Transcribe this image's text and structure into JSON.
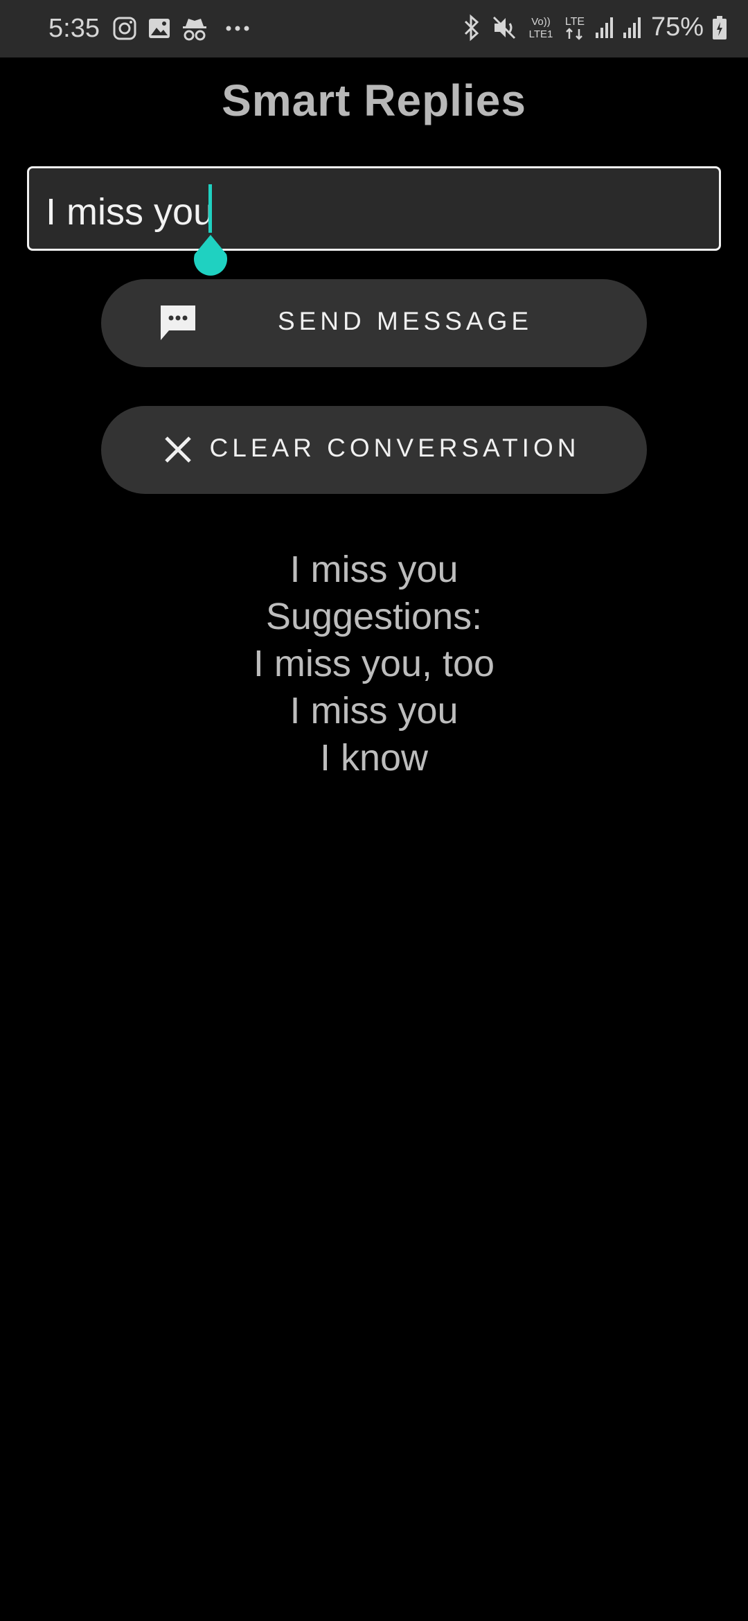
{
  "status_bar": {
    "time": "5:35",
    "left_icons": [
      "instagram-icon",
      "gallery-icon",
      "incognito-icon",
      "more-dots-icon"
    ],
    "right_icons": [
      "bluetooth-icon",
      "mute-icon",
      "volte-icon",
      "lte-icon",
      "signal-icon",
      "signal-icon",
      "battery-icon"
    ],
    "volte_label": "Vo))\nLTE1",
    "lte_label": "LTE",
    "battery": "75%"
  },
  "app": {
    "title": "Smart Replies"
  },
  "input": {
    "value": "I miss you",
    "accent_color": "#1fd1c1"
  },
  "buttons": {
    "send_label": "SEND MESSAGE",
    "send_icon": "message-icon",
    "clear_label": "CLEAR CONVERSATION",
    "clear_icon": "close-icon"
  },
  "output": {
    "message": "I miss you",
    "suggestions_label": "Suggestions:",
    "suggestions": [
      "I miss you, too",
      "I miss you",
      "I know"
    ]
  }
}
